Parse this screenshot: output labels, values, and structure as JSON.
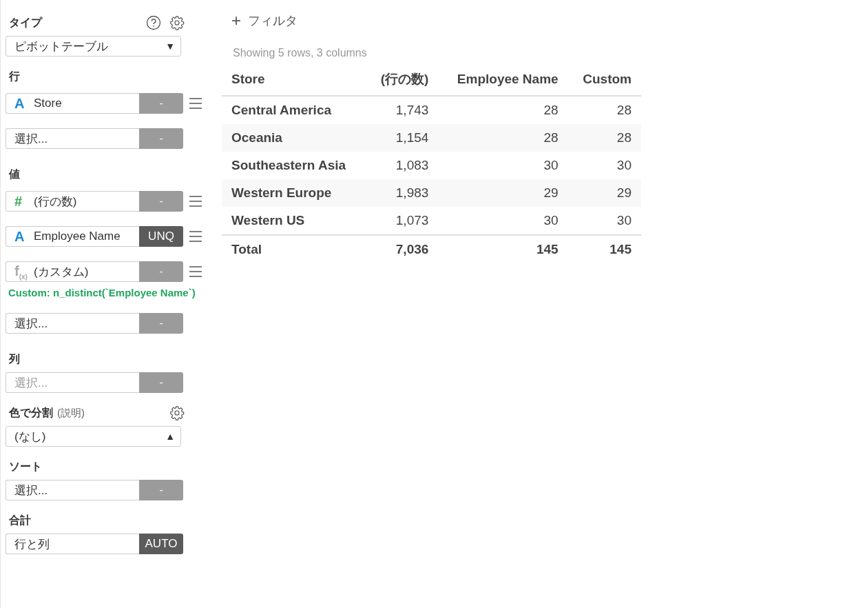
{
  "sidebar": {
    "sections": [
      {
        "kind": "type",
        "title": "タイプ",
        "items": [
          {
            "kind": "dropdown",
            "value": "ピボットテーブル",
            "caret": "▼"
          }
        ]
      },
      {
        "kind": "rows",
        "title": "行",
        "items": [
          {
            "kind": "field",
            "icon": {
              "text": "A",
              "color": "#1a8ad6"
            },
            "label": "Store",
            "action": "-",
            "action_dark": false,
            "handle": true
          },
          {
            "kind": "picker",
            "label": "選択...",
            "muted": false,
            "action": "-"
          }
        ]
      },
      {
        "kind": "values",
        "title": "値",
        "items": [
          {
            "kind": "field",
            "icon": {
              "text": "#",
              "color": "#3aa655"
            },
            "label": "(行の数)",
            "action": "-",
            "action_dark": false,
            "handle": true
          },
          {
            "kind": "field",
            "icon": {
              "text": "A",
              "color": "#1a8ad6"
            },
            "label": "Employee Name",
            "action": "UNQ",
            "action_dark": true,
            "handle": true
          },
          {
            "kind": "field",
            "icon": {
              "text": "f$_{(x)}$",
              "color": "#aaaaaa"
            },
            "label": "(カスタム)",
            "action": "-",
            "action_dark": false,
            "handle": true,
            "note": "Custom: n_distinct(`Employee Name`)"
          },
          {
            "kind": "picker",
            "label": "選択...",
            "muted": false,
            "action": "-"
          }
        ]
      },
      {
        "kind": "columns",
        "title": "列",
        "items": [
          {
            "kind": "picker",
            "label": "選択...",
            "muted": true,
            "action": "-"
          }
        ]
      },
      {
        "kind": "color",
        "title": "色で分割",
        "hint": "(説明)",
        "items": [
          {
            "kind": "dropdown",
            "value": "(なし)",
            "caret": "▲"
          }
        ]
      },
      {
        "kind": "sort",
        "title": "ソート",
        "items": [
          {
            "kind": "picker",
            "label": "選択...",
            "muted": false,
            "action": "-"
          }
        ]
      },
      {
        "kind": "total",
        "title": "合計",
        "items": [
          {
            "kind": "field",
            "label": "行と列",
            "action": "AUTO",
            "action_dark": true,
            "handle": false
          }
        ]
      }
    ]
  },
  "filter": {
    "icon": "+",
    "label": "フィルタ"
  },
  "summary": "Showing 5 rows, 3 columns",
  "table": {
    "columns": [
      "Store",
      "(行の数)",
      "Employee Name",
      "Custom"
    ],
    "rows": [
      [
        "Central America",
        "1,743",
        "28",
        "28"
      ],
      [
        "Oceania",
        "1,154",
        "28",
        "28"
      ],
      [
        "Southeastern Asia",
        "1,083",
        "30",
        "30"
      ],
      [
        "Western Europe",
        "1,983",
        "29",
        "29"
      ],
      [
        "Western US",
        "1,073",
        "30",
        "30"
      ]
    ],
    "total": [
      "Total",
      "7,036",
      "145",
      "145"
    ]
  }
}
